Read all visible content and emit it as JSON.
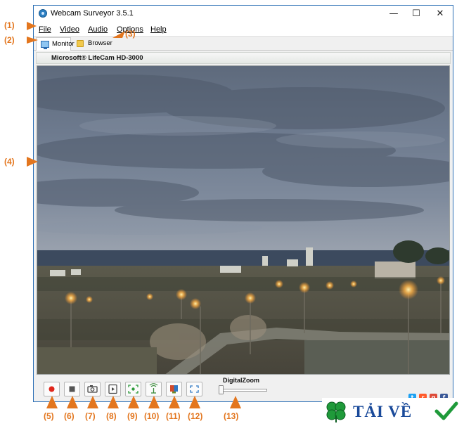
{
  "window": {
    "title": "Webcam Surveyor 3.5.1",
    "controls": {
      "minimize": "—",
      "maximize": "☐",
      "close": "✕"
    }
  },
  "menu": [
    "File",
    "Video",
    "Audio",
    "Options",
    "Help"
  ],
  "tabs": [
    {
      "label": "Monitor",
      "icon": "monitor-icon",
      "active": true
    },
    {
      "label": "Browser",
      "icon": "folder-icon",
      "active": false
    }
  ],
  "camera": {
    "name": "Microsoft® LifeCam HD-3000"
  },
  "toolbar": {
    "buttons": [
      {
        "name": "record-button",
        "icon": "record-icon",
        "color": "#e0261b"
      },
      {
        "name": "stop-button",
        "icon": "stop-icon",
        "color": "#555555"
      },
      {
        "name": "snapshot-button",
        "icon": "camera-icon",
        "color": "#444444"
      },
      {
        "name": "playback-button",
        "icon": "play-file-icon",
        "color": "#444444"
      },
      {
        "name": "motion-detection-button",
        "icon": "motion-icon",
        "color": "#2e9b3c"
      },
      {
        "name": "broadcast-button",
        "icon": "antenna-icon",
        "color": "#3a8a3a"
      },
      {
        "name": "video-effects-button",
        "icon": "effects-icon",
        "color": "#d24a2a"
      },
      {
        "name": "fullscreen-button",
        "icon": "fullscreen-icon",
        "color": "#2f78c4"
      }
    ],
    "zoom": {
      "label": "DigitalZoom",
      "value": 0
    }
  },
  "share": [
    {
      "name": "twitter-icon",
      "glyph": "t",
      "color": "#1da1f2"
    },
    {
      "name": "reddit-icon",
      "glyph": "r",
      "color": "#ff5a2a"
    },
    {
      "name": "google-plus-icon",
      "glyph": "g",
      "color": "#dd4b39"
    },
    {
      "name": "facebook-icon",
      "glyph": "f",
      "color": "#3b5998"
    }
  ],
  "callouts": [
    "(1)",
    "(2)",
    "(3)",
    "(4)",
    "(5)",
    "(6)",
    "(7)",
    "(8)",
    "(9)",
    "(10)",
    "(11)",
    "(12)",
    "(13)"
  ],
  "watermark": {
    "text": "TẢI VỀ"
  }
}
